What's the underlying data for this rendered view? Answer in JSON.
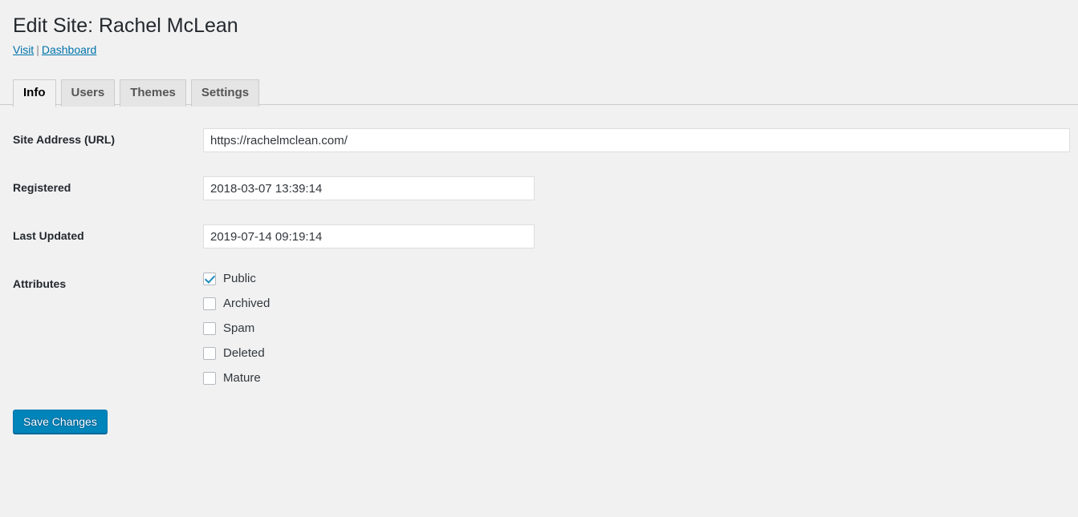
{
  "header": {
    "title": "Edit Site: Rachel McLean",
    "links": [
      {
        "label": "Visit",
        "name": "visit-link"
      },
      {
        "label": "Dashboard",
        "name": "dashboard-link"
      }
    ],
    "separator": "|"
  },
  "tabs": [
    {
      "label": "Info",
      "active": true
    },
    {
      "label": "Users",
      "active": false
    },
    {
      "label": "Themes",
      "active": false
    },
    {
      "label": "Settings",
      "active": false
    }
  ],
  "form": {
    "site_address": {
      "label": "Site Address (URL)",
      "value": "https://rachelmclean.com/",
      "placeholder": ""
    },
    "registered": {
      "label": "Registered",
      "value": "2018-03-07 13:39:14",
      "placeholder": ""
    },
    "last_updated": {
      "label": "Last Updated",
      "value": "2019-07-14 09:19:14",
      "placeholder": ""
    },
    "attributes": {
      "label": "Attributes",
      "options": [
        {
          "label": "Public",
          "checked": true
        },
        {
          "label": "Archived",
          "checked": false
        },
        {
          "label": "Spam",
          "checked": false
        },
        {
          "label": "Deleted",
          "checked": false
        },
        {
          "label": "Mature",
          "checked": false
        }
      ]
    }
  },
  "submit": {
    "label": "Save Changes"
  },
  "colors": {
    "background": "#f1f1f1",
    "link": "#0073aa",
    "button_primary": "#0085ba",
    "checkmark": "#1e8cbe",
    "text": "#23282d"
  }
}
